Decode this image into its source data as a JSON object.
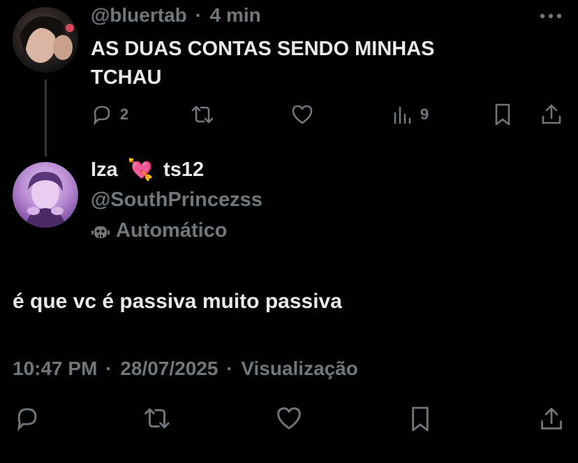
{
  "parent_tweet": {
    "handle": "@bluertab",
    "separator": "·",
    "time": "4 min",
    "text_line1": "AS DUAS CONTAS SENDO MINHAS",
    "text_line2": "TCHAU",
    "replies_count": "2",
    "views_count": "9"
  },
  "main_tweet": {
    "display_name_left": "Iza",
    "emoji": "💘",
    "display_name_right": "ts12",
    "handle": "@SouthPrincezss",
    "automated_label": "Automático",
    "text": "é que vc é passiva muito passiva",
    "time": "10:47 PM",
    "date": "28/07/2025",
    "views_label": "Visualização",
    "dot": "·"
  },
  "icons": {
    "more": "more-icon",
    "reply": "reply-icon",
    "retweet": "retweet-icon",
    "like": "heart-icon",
    "views": "views-icon",
    "bookmark": "bookmark-icon",
    "share": "share-icon",
    "automated": "robot-icon"
  },
  "colors": {
    "background": "#000000",
    "text_primary": "#e7e9ea",
    "text_secondary": "#71767b"
  }
}
